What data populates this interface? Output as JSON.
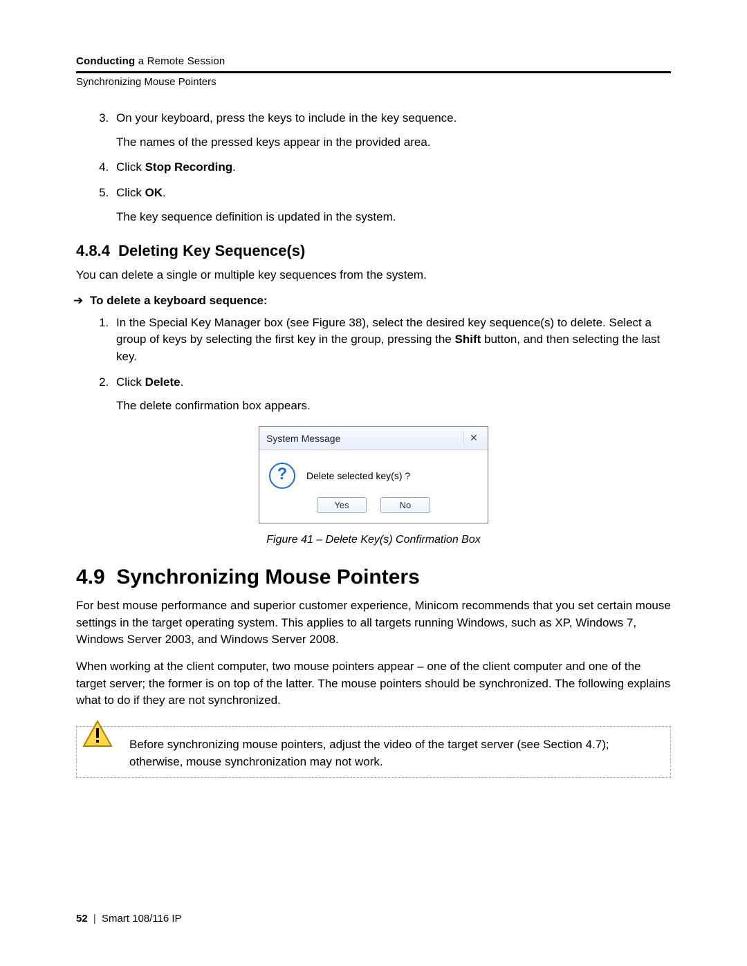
{
  "header": {
    "chapter_bold": "Conducting",
    "chapter_rest": " a Remote Session",
    "section": "Synchronizing Mouse Pointers"
  },
  "top_steps": {
    "s3": "On your keyboard, press the keys to include in the key sequence.",
    "s3_sub": "The names of the pressed keys appear in the provided area.",
    "s4_pre": "Click ",
    "s4_b": "Stop Recording",
    "s4_post": ".",
    "s5_pre": "Click ",
    "s5_b": "OK",
    "s5_post": ".",
    "s5_sub": "The key sequence definition is updated in the system."
  },
  "del_section": {
    "num": "4.8.4",
    "title": "Deleting Key Sequence(s)",
    "intro": "You can delete a single or multiple key sequences from the system.",
    "lead": "To delete a keyboard sequence:",
    "s1a": "In the Special Key Manager box (see Figure 38), select the desired key sequence(s) to delete. Select a group of keys by selecting the first key in the group, pressing the ",
    "s1b": "Shift",
    "s1c": " button, and then selecting the last key.",
    "s2_pre": "Click ",
    "s2_b": "Delete",
    "s2_post": ".",
    "s2_sub": "The delete confirmation box appears."
  },
  "dialog": {
    "title": "System Message",
    "close": "✕",
    "message": "Delete selected key(s) ?",
    "yes": "Yes",
    "no": "No"
  },
  "caption": "Figure 41 – Delete Key(s) Confirmation Box",
  "sync": {
    "num": "4.9",
    "title": "Synchronizing Mouse Pointers",
    "p1": "For best mouse performance and superior customer experience, Minicom recommends that you set certain mouse settings in the target operating system. This applies to all targets running Windows, such as XP, Windows 7, Windows Server 2003, and Windows Server 2008.",
    "p2": "When working at the client computer, two mouse pointers appear – one of the client computer and one of the target server; the former is on top of the latter. The mouse pointers should be synchronized. The following explains what to do if they are not synchronized.",
    "warn": "Before synchronizing mouse pointers, adjust the video of the target server (see Section 4.7); otherwise, mouse synchronization may not work."
  },
  "footer": {
    "page": "52",
    "product": "Smart 108/116 IP"
  }
}
